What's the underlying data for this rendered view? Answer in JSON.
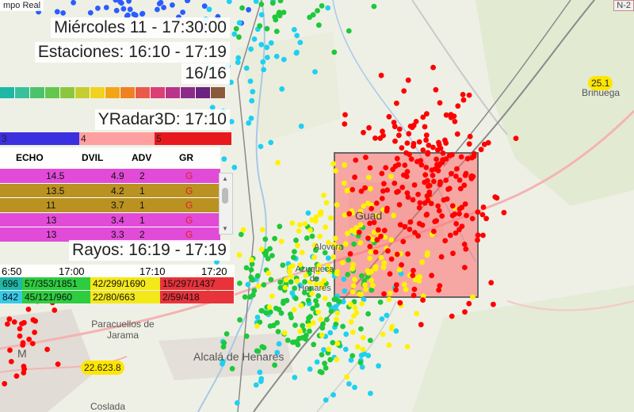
{
  "header": {
    "corner_label": "mpo Real",
    "datetime": "Miércoles 11 - 17:30:00",
    "stations_label": "Estaciones: 16:10 - 17:19",
    "stations_count": "16/16",
    "radar_label": "YRadar3D: 17:10",
    "rayos_label": "Rayos: 16:19 - 17:19"
  },
  "colorbar_colors": [
    "#1fb7a6",
    "#3ac19b",
    "#4cc36b",
    "#62c74c",
    "#8cc63f",
    "#c5cd2f",
    "#f0d21f",
    "#f3a518",
    "#f08021",
    "#e85a4a",
    "#db3f76",
    "#b8348a",
    "#8c2b8a",
    "#6a2380",
    "#8a5a3a"
  ],
  "yradar_bar": [
    {
      "label": "3",
      "color": "#3b2fe0"
    },
    {
      "label": "4",
      "color": "#ff9fa0"
    },
    {
      "label": "5",
      "color": "#e8191e"
    }
  ],
  "table": {
    "headers": [
      "ECHO",
      "DVIL",
      "ADV",
      "GR"
    ],
    "rows": [
      {
        "echo": "14.5",
        "dvil": "4.9",
        "adv": "2",
        "gr": "G",
        "color": "#e14bd8"
      },
      {
        "echo": "13.5",
        "dvil": "4.2",
        "adv": "1",
        "gr": "G",
        "color": "#b99222"
      },
      {
        "echo": "11",
        "dvil": "3.7",
        "adv": "1",
        "gr": "G",
        "color": "#b99222"
      },
      {
        "echo": "13",
        "dvil": "3.4",
        "adv": "1",
        "gr": "G",
        "color": "#e14bd8"
      },
      {
        "echo": "13",
        "dvil": "3.3",
        "adv": "2",
        "gr": "G",
        "color": "#e14bd8"
      }
    ]
  },
  "rayos": {
    "times": [
      "6:50",
      "17:00",
      "17:10",
      "17:20"
    ],
    "rows": [
      [
        {
          "text": "696",
          "color": "#1fb7a6"
        },
        {
          "text": "57/353/1851",
          "color": "#2ecc40"
        },
        {
          "text": "42/299/1690",
          "color": "#f4e81a"
        },
        {
          "text": "15/297/1437",
          "color": "#e8333a"
        }
      ],
      [
        {
          "text": "842",
          "color": "#38c9e8"
        },
        {
          "text": "45/121/960",
          "color": "#2ecc40"
        },
        {
          "text": "22/80/663",
          "color": "#f4e81a"
        },
        {
          "text": "2/59/418",
          "color": "#e8333a"
        }
      ]
    ]
  },
  "map": {
    "labels": {
      "guadalajara": "Guad",
      "paracuellos": "Paracuellos de Jarama",
      "alcala": "Alcalá de Henares",
      "coslada": "Coslada",
      "brihuega": "Brihuega",
      "madrid": "M",
      "alovera": "Alovera",
      "azuqueca": "Azuqueca de Henares"
    },
    "badges": {
      "brihuega": "25.1",
      "madrid": "22.623.8"
    },
    "top_right": "N-2"
  }
}
